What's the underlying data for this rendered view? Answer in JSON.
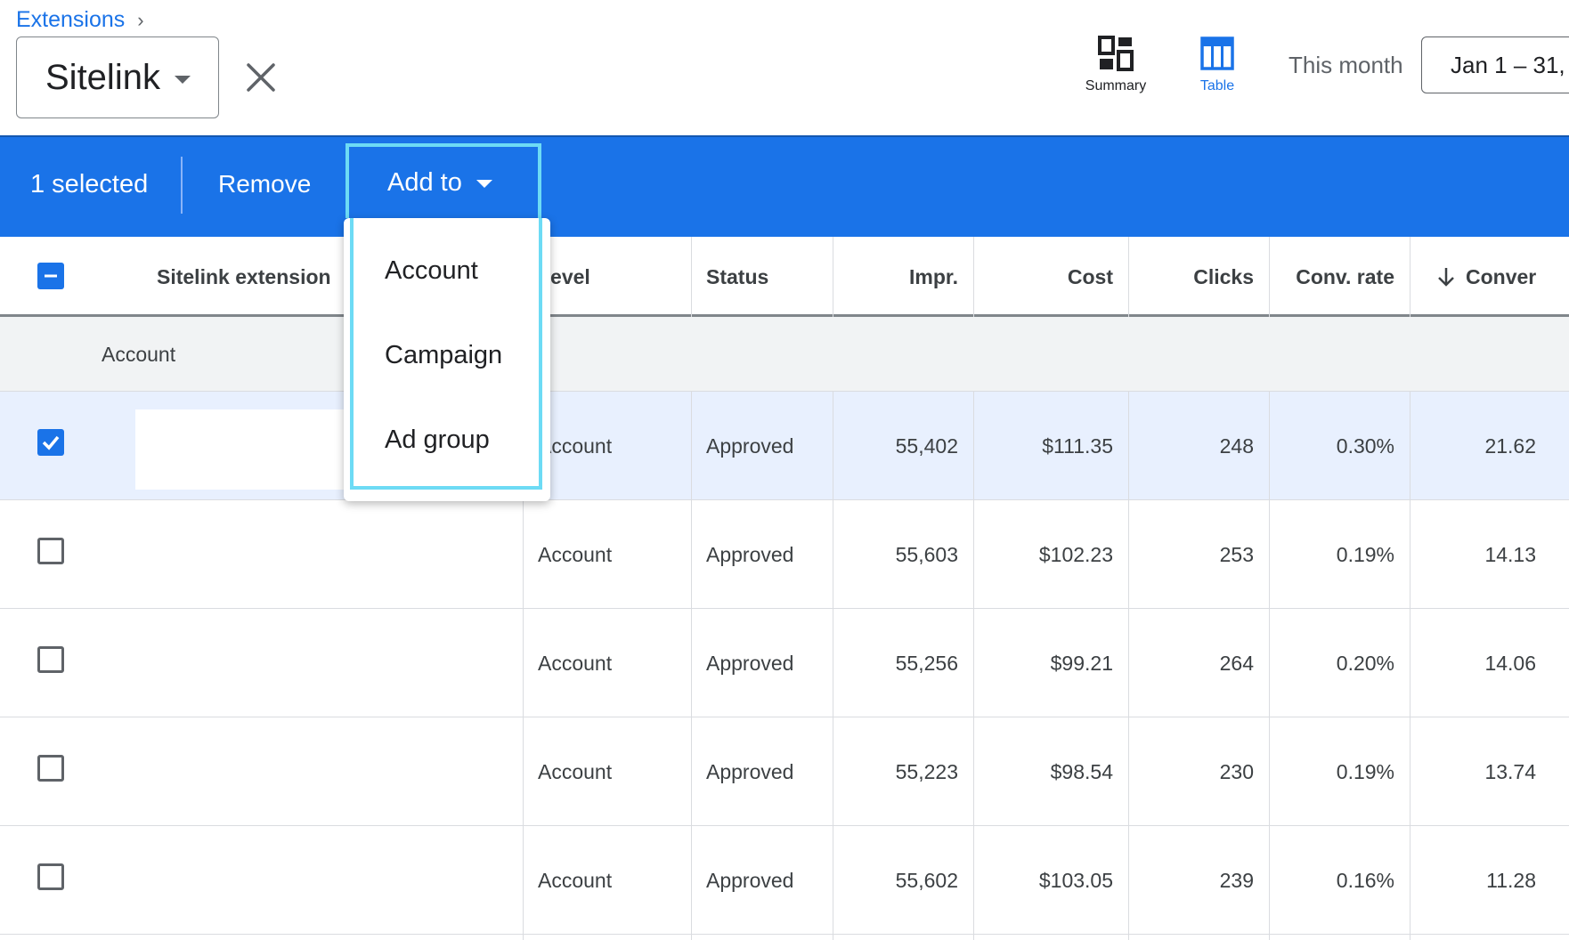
{
  "header": {
    "breadcrumb": "Extensions",
    "extension_type": "Sitelink",
    "views": {
      "summary_label": "Summary",
      "table_label": "Table"
    },
    "date_range_label": "This month",
    "date_range_value": "Jan 1 – 31,"
  },
  "selection_bar": {
    "count_text": "1 selected",
    "remove_label": "Remove",
    "add_to_label": "Add to"
  },
  "add_to_menu": {
    "items": [
      "Account",
      "Campaign",
      "Ad group"
    ]
  },
  "table": {
    "columns": [
      "Sitelink extension",
      "Level",
      "Status",
      "Impr.",
      "Cost",
      "Clicks",
      "Conv. rate",
      "Conver"
    ],
    "group_label": "Account",
    "rows": [
      {
        "selected": true,
        "level": "Account",
        "status": "Approved",
        "impr": "55,402",
        "cost": "$111.35",
        "clicks": "248",
        "conv_rate": "0.30%",
        "conversions": "21.62"
      },
      {
        "selected": false,
        "level": "Account",
        "status": "Approved",
        "impr": "55,603",
        "cost": "$102.23",
        "clicks": "253",
        "conv_rate": "0.19%",
        "conversions": "14.13"
      },
      {
        "selected": false,
        "level": "Account",
        "status": "Approved",
        "impr": "55,256",
        "cost": "$99.21",
        "clicks": "264",
        "conv_rate": "0.20%",
        "conversions": "14.06"
      },
      {
        "selected": false,
        "level": "Account",
        "status": "Approved",
        "impr": "55,223",
        "cost": "$98.54",
        "clicks": "230",
        "conv_rate": "0.19%",
        "conversions": "13.74"
      },
      {
        "selected": false,
        "level": "Account",
        "status": "Approved",
        "impr": "55,602",
        "cost": "$103.05",
        "clicks": "239",
        "conv_rate": "0.16%",
        "conversions": "11.28"
      }
    ]
  },
  "colors": {
    "accent": "#1a73e8",
    "highlight_border": "#6ddbf5",
    "selected_row": "#e8f0fe",
    "group_row": "#f1f3f4"
  }
}
